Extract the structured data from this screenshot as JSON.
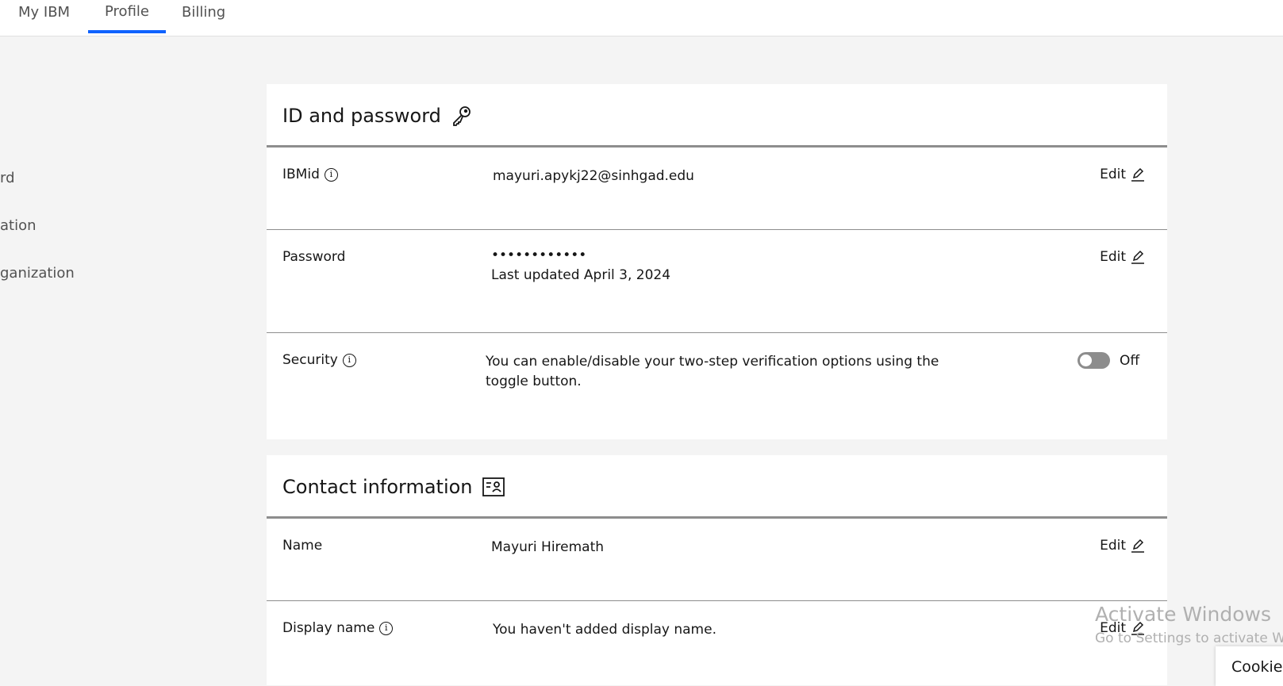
{
  "tabs": [
    {
      "label": "My IBM"
    },
    {
      "label": "Profile",
      "active": true
    },
    {
      "label": "Billing"
    }
  ],
  "sidebar": {
    "items": [
      {
        "label": "rd"
      },
      {
        "label": "ation"
      },
      {
        "label": "ganization"
      }
    ]
  },
  "id_password": {
    "title": "ID and password",
    "icon": "key-icon",
    "ibmid": {
      "label": "IBMid",
      "value": "mayuri.apykj22@sinhgad.edu",
      "edit": "Edit"
    },
    "password": {
      "label": "Password",
      "value": "••••••••••••",
      "updated": "Last updated April 3, 2024",
      "edit": "Edit"
    },
    "security": {
      "label": "Security",
      "text": "You can enable/disable your two-step verification options using the toggle button.",
      "toggle_state": "Off",
      "enabled": false
    }
  },
  "contact": {
    "title": "Contact information",
    "icon": "contact-card-icon",
    "name": {
      "label": "Name",
      "value": "Mayuri Hiremath",
      "edit": "Edit"
    },
    "display_name": {
      "label": "Display name",
      "value": "You haven't added display name.",
      "edit": "Edit"
    }
  },
  "watermark": {
    "line1": "Activate Windows",
    "line2": "Go to Settings to activate Win"
  },
  "cookie": {
    "label": "Cookie"
  },
  "colors": {
    "accent": "#0f62fe",
    "toggle_off": "#8d8d8d"
  }
}
